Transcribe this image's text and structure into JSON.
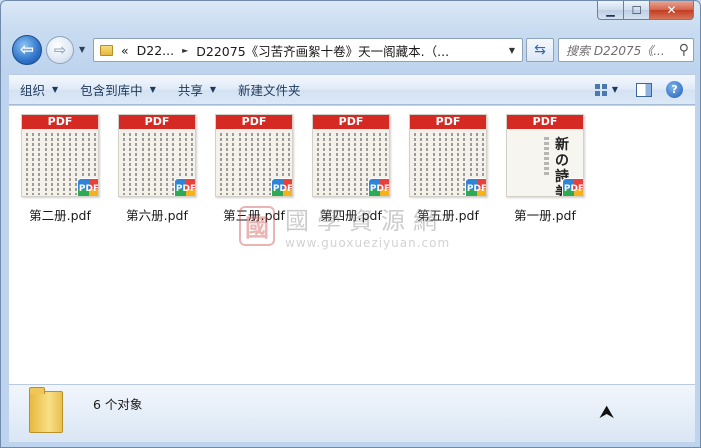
{
  "window": {
    "caption": {
      "minimize": "▁",
      "maximize": "☐",
      "close": "✕"
    }
  },
  "nav": {
    "back_glyph": "⇦",
    "forward_glyph": "⇨",
    "address": {
      "prefix": "«",
      "crumb1": "D22...",
      "crumb2": "D22075《习苦齐画絮十卷》天一阁藏本.（..."
    },
    "search_placeholder": "搜索 D22075《..."
  },
  "toolbar": {
    "organize": "组织",
    "include_in_library": "包含到库中",
    "share": "共享",
    "new_folder": "新建文件夹"
  },
  "files": [
    {
      "name": "第二册.pdf",
      "band": "PDF",
      "badge": "PDF",
      "kind": "page"
    },
    {
      "name": "第六册.pdf",
      "band": "PDF",
      "badge": "PDF",
      "kind": "page"
    },
    {
      "name": "第三册.pdf",
      "band": "PDF",
      "badge": "PDF",
      "kind": "page"
    },
    {
      "name": "第四册.pdf",
      "band": "PDF",
      "badge": "PDF",
      "kind": "page"
    },
    {
      "name": "第五册.pdf",
      "band": "PDF",
      "badge": "PDF",
      "kind": "page"
    },
    {
      "name": "第一册.pdf",
      "band": "PDF",
      "badge": "PDF",
      "kind": "cover"
    }
  ],
  "cover_title": "新の詩美",
  "watermark": {
    "seal": "國",
    "chinese": "國學資源網",
    "url": "www.guoxueziyuan.com"
  },
  "status": {
    "count_text": "6 个对象"
  },
  "colors": {
    "pdf_red": "#d42a23",
    "accent": "#2f74c8"
  }
}
